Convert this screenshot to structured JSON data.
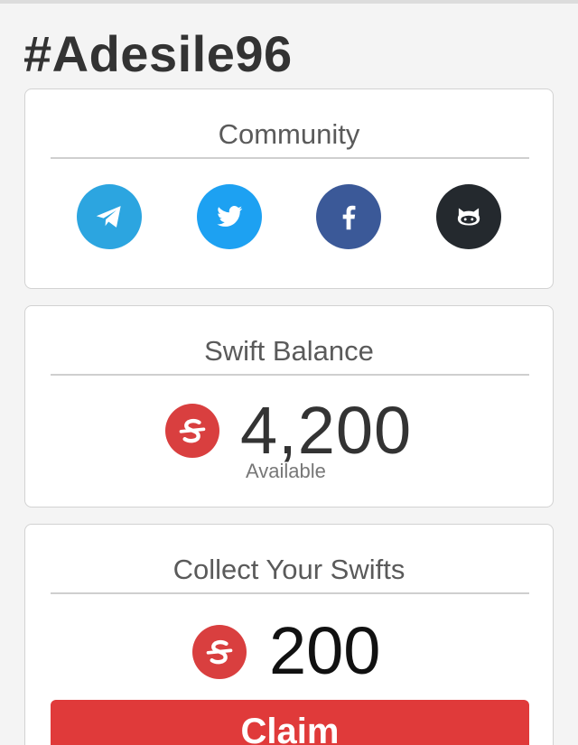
{
  "header": {
    "username": "#Adesile96"
  },
  "community": {
    "title": "Community",
    "links": [
      {
        "icon": "telegram-icon",
        "color": "#2ca5e0"
      },
      {
        "icon": "twitter-icon",
        "color": "#1da1f2"
      },
      {
        "icon": "facebook-icon",
        "color": "#3b5998"
      },
      {
        "icon": "github-icon",
        "color": "#24292e"
      }
    ]
  },
  "balance": {
    "title": "Swift Balance",
    "amount": "4,200",
    "caption": "Available",
    "coin_icon": "swift-coin-icon",
    "coin_color": "#d93f3f"
  },
  "collect": {
    "title": "Collect Your Swifts",
    "amount": "200",
    "coin_icon": "swift-coin-icon",
    "claim_label": "Claim",
    "claim_color": "#e03a3a"
  }
}
